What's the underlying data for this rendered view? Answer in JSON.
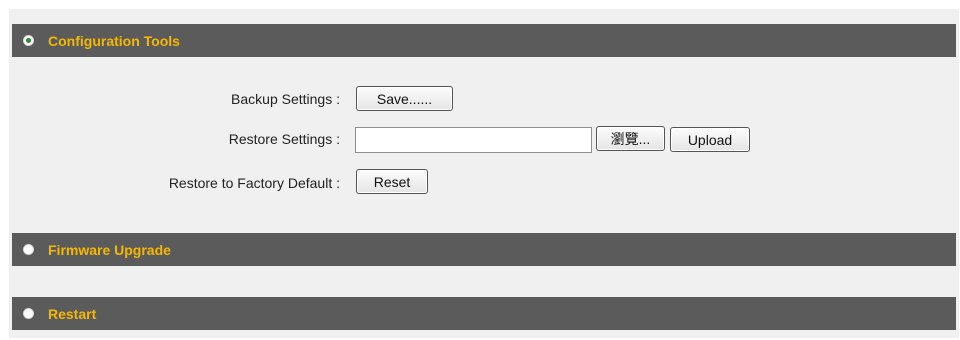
{
  "sections": {
    "config": {
      "title": "Configuration Tools"
    },
    "firmware": {
      "title": "Firmware Upgrade"
    },
    "restart": {
      "title": "Restart"
    }
  },
  "config": {
    "backup": {
      "label": "Backup Settings :",
      "button": "Save......"
    },
    "restore": {
      "label": "Restore Settings :",
      "file_value": "",
      "browse_button": "瀏覽...",
      "upload_button": "Upload"
    },
    "factory": {
      "label": "Restore to Factory Default :",
      "button": "Reset"
    }
  },
  "colors": {
    "bar_background": "#5b5b5b",
    "bar_text": "#f5b800",
    "panel_background": "#f0f0f0",
    "selected_dot": "#2d8a2d"
  },
  "icons": {
    "radio_selected": "radio-selected-icon",
    "radio_unselected": "radio-unselected-icon"
  }
}
